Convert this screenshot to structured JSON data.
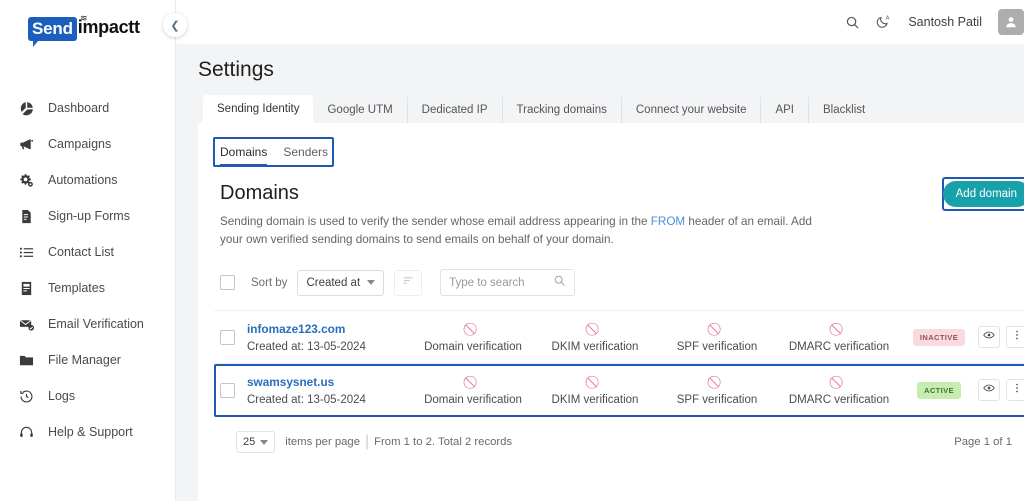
{
  "brand": {
    "logo_primary": "Send",
    "logo_secondary": "impactt",
    "accent": "#1b5fbe"
  },
  "sidebar": {
    "collapse_icon": "chevron-left-icon",
    "items": [
      {
        "label": "Dashboard",
        "icon": "pie-chart-icon"
      },
      {
        "label": "Campaigns",
        "icon": "megaphone-icon"
      },
      {
        "label": "Automations",
        "icon": "gears-icon"
      },
      {
        "label": "Sign-up Forms",
        "icon": "form-document-icon"
      },
      {
        "label": "Contact List",
        "icon": "list-icon"
      },
      {
        "label": "Templates",
        "icon": "template-document-icon"
      },
      {
        "label": "Email Verification",
        "icon": "mail-check-icon"
      },
      {
        "label": "File Manager",
        "icon": "folder-icon"
      },
      {
        "label": "Logs",
        "icon": "history-clock-icon"
      },
      {
        "label": "Help & Support",
        "icon": "headset-icon"
      }
    ]
  },
  "topbar": {
    "search_icon": "search-icon",
    "theme_icon": "moon-auto-icon",
    "user_name": "Santosh Patil",
    "avatar_icon": "user-avatar-icon",
    "caret_icon": "chevron-down-icon"
  },
  "page": {
    "title": "Settings"
  },
  "tabs": [
    {
      "label": "Sending Identity",
      "active": true
    },
    {
      "label": "Google UTM",
      "active": false
    },
    {
      "label": "Dedicated IP",
      "active": false
    },
    {
      "label": "Tracking domains",
      "active": false
    },
    {
      "label": "Connect your website",
      "active": false
    },
    {
      "label": "API",
      "active": false
    },
    {
      "label": "Blacklist",
      "active": false
    }
  ],
  "subtabs": [
    {
      "label": "Domains",
      "active": true
    },
    {
      "label": "Senders",
      "active": false
    }
  ],
  "section": {
    "title": "Domains",
    "desc_part1": "Sending domain is used to verify the sender whose email address appearing in the ",
    "desc_link": "FROM",
    "desc_part2": " header of an email. Add your own verified sending domains to send emails on behalf of your domain.",
    "add_button": "Add domain"
  },
  "toolbar": {
    "select_all_icon": "checkbox-icon",
    "sort_by_label": "Sort by",
    "sort_value": "Created at",
    "sort_direction_icon": "sort-descending-icon",
    "search_placeholder": "Type to search",
    "search_value": "",
    "search_icon": "search-icon"
  },
  "table": {
    "verification_columns": [
      "Domain verification",
      "DKIM verification",
      "SPF verification",
      "DMARC verification"
    ],
    "rows": [
      {
        "domain": "infomaze123.com",
        "created": "Created at: 13-05-2024",
        "domain_verification": "Domain verification",
        "dkim_verification": "DKIM verification",
        "spf_verification": "SPF verification",
        "dmarc_verification": "DMARC verification",
        "status": "INACTIVE",
        "status_kind": "inactive",
        "view_icon": "eye-icon",
        "menu_icon": "kebab-menu-icon",
        "highlighted": false
      },
      {
        "domain": "swamsysnet.us",
        "created": "Created at: 13-05-2024",
        "domain_verification": "Domain verification",
        "dkim_verification": "DKIM verification",
        "spf_verification": "SPF verification",
        "dmarc_verification": "DMARC verification",
        "status": "ACTIVE",
        "status_kind": "active",
        "view_icon": "eye-icon",
        "menu_icon": "kebab-menu-icon",
        "highlighted": true
      }
    ]
  },
  "footer": {
    "per_page": "25",
    "per_page_label": "items per page",
    "range_text": "From 1 to 2. Total 2 records",
    "page_info": "Page 1 of 1"
  },
  "colors": {
    "teal_button": "#17a2ab",
    "annotation_blue": "#2257b5",
    "link_blue": "#2a6ebb",
    "badge_active_bg": "#c6ecb0",
    "badge_inactive_bg": "#fadbdd",
    "verif_icon": "#e36c8a"
  }
}
